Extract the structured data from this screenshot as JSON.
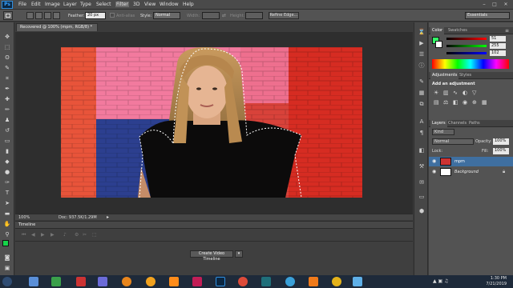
{
  "app": {
    "logo": "Ps"
  },
  "menu": [
    "File",
    "Edit",
    "Image",
    "Layer",
    "Type",
    "Select",
    "Filter",
    "3D",
    "View",
    "Window",
    "Help"
  ],
  "workspace": "Essentials",
  "window_controls": {
    "minimize": "–",
    "maximize": "□",
    "close": "✕"
  },
  "options": {
    "feather_label": "Feather:",
    "feather_value": "20 px",
    "antialias_label": "Anti-alias",
    "style_label": "Style:",
    "style_value": "Normal",
    "width_label": "Width:",
    "height_label": "Height:",
    "refine_edge": "Refine Edge..."
  },
  "document": {
    "tab_title": "Recovered @ 100% (mpm, RGB/8) *",
    "zoom": "100%",
    "doc_size": "Doc: 937.5K/1.29M"
  },
  "timeline": {
    "title": "Timeline",
    "create_button": "Create Video Timeline"
  },
  "color_panel": {
    "tabs": [
      "Color",
      "Swatches"
    ],
    "values": [
      "51",
      "255",
      "102"
    ],
    "fg_color": "#33ff66",
    "bg_color": "#ffffff"
  },
  "adjustments_panel": {
    "tabs": [
      "Adjustments",
      "Styles"
    ],
    "heading": "Add an adjustment"
  },
  "layers_panel": {
    "tabs": [
      "Layers",
      "Channels",
      "Paths"
    ],
    "kind_label": "Kind",
    "blend_mode": "Normal",
    "opacity_label": "Opacity:",
    "opacity_value": "100%",
    "lock_label": "Lock:",
    "fill_label": "Fill:",
    "fill_value": "100%",
    "layers": [
      {
        "name": "mpm",
        "selected": true
      },
      {
        "name": "Background",
        "selected": false
      }
    ]
  },
  "taskbar": {
    "time": "1:30 PM",
    "date": "7/21/2019"
  }
}
